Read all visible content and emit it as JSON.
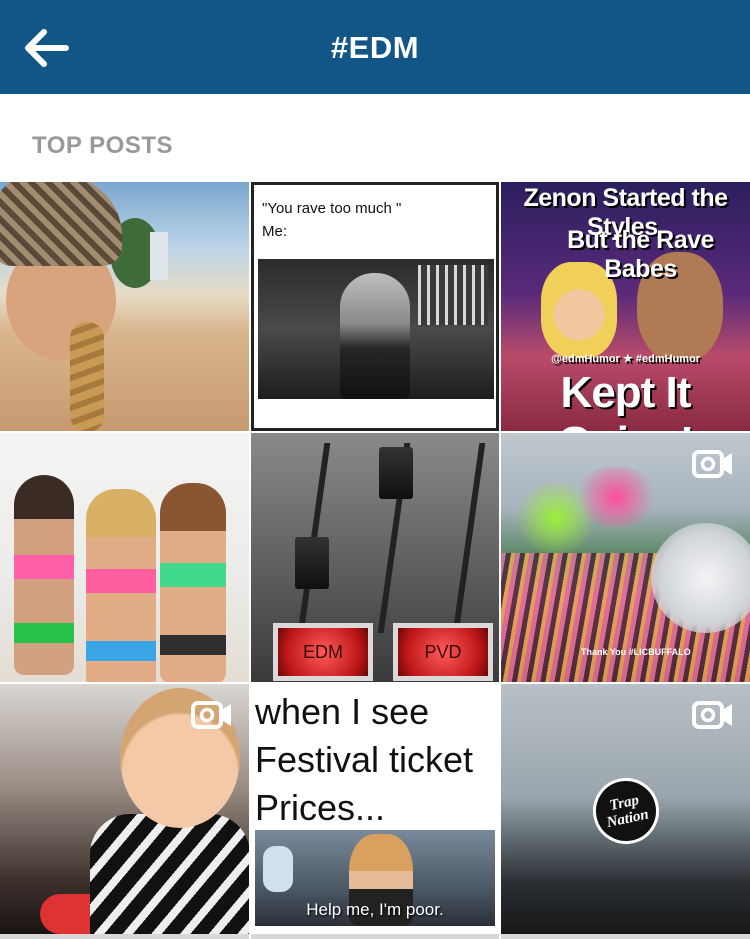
{
  "header": {
    "title": "#EDM",
    "back_icon": "arrow-left-icon",
    "background_color": "#125688"
  },
  "section": {
    "label": "TOP POSTS"
  },
  "posts": [
    {
      "type": "photo"
    },
    {
      "type": "photo",
      "text": [
        "\"You rave too much \"",
        "Me:"
      ]
    },
    {
      "type": "photo",
      "text": [
        "Zenon Started the Styles,",
        "But the Rave Babes",
        "@edmHumor ★ #edmHumor",
        "Kept It Going!"
      ]
    },
    {
      "type": "photo"
    },
    {
      "type": "photo",
      "text": [
        "EDM",
        "PVD"
      ]
    },
    {
      "type": "video",
      "text": [
        "Thank You #LICBUFFALO"
      ]
    },
    {
      "type": "video"
    },
    {
      "type": "photo",
      "text": [
        "when I see",
        "Festival ticket",
        "Prices...",
        "Help me, I'm poor."
      ]
    },
    {
      "type": "video",
      "text": [
        "Trap",
        "Nation"
      ]
    }
  ],
  "icons": {
    "video": "video-camera-icon"
  }
}
